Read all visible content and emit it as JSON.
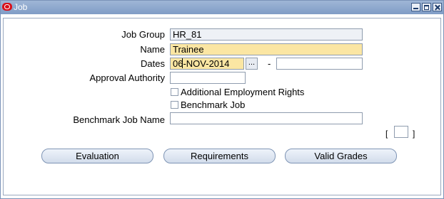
{
  "window": {
    "title": "Job"
  },
  "form": {
    "job_group": {
      "label": "Job Group",
      "value": "HR_81"
    },
    "name": {
      "label": "Name",
      "value": "Trainee"
    },
    "dates": {
      "label": "Dates",
      "from_value": "06-NOV-2014",
      "lov_label": "...",
      "separator": "-",
      "to_value": ""
    },
    "approval_authority": {
      "label": "Approval Authority",
      "value": ""
    },
    "additional_employment_rights": {
      "label": "Additional Employment Rights",
      "checked": false
    },
    "benchmark_job": {
      "label": "Benchmark Job",
      "checked": false
    },
    "benchmark_job_name": {
      "label": "Benchmark Job Name",
      "value": ""
    },
    "dff": {
      "open": "[",
      "close": "]"
    }
  },
  "buttons": {
    "evaluation": "Evaluation",
    "requirements": "Requirements",
    "valid_grades": "Valid Grades"
  },
  "colors": {
    "required_field": "#fbe6a3",
    "titlebar": "#8aa6cf"
  }
}
